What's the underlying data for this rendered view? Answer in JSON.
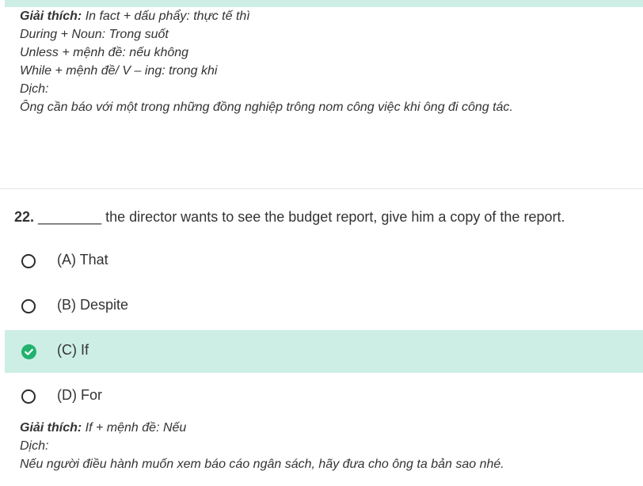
{
  "previous": {
    "explain_label": "Giải thích:",
    "explain_lines": [
      "In fact + dấu phẩy: thực tế thì",
      "During + Noun: Trong suốt",
      "Unless + mệnh đề: nếu không",
      "While + mệnh đề/ V – ing: trong khi"
    ],
    "translate_label": "Dịch:",
    "translation": "Ông cần báo với một trong những đồng nghiệp trông nom công việc khi ông đi công tác."
  },
  "question": {
    "number": "22.",
    "blank": "________",
    "text": " the director wants to see the budget report, give him a copy of the report.",
    "options": [
      {
        "label": "(A) That",
        "selected": false
      },
      {
        "label": "(B) Despite",
        "selected": false
      },
      {
        "label": "(C) If",
        "selected": true
      },
      {
        "label": "(D) For",
        "selected": false
      }
    ],
    "explain_label": "Giải thích:",
    "explain_text": " If + mệnh đề: Nếu",
    "translate_label": "Dịch:",
    "translation": "Nếu người điều hành muốn xem báo cáo ngân sách, hãy đưa cho ông ta bản sao nhé."
  },
  "colors": {
    "selected_bg": "#cdeee4",
    "check_green": "#22b26e"
  },
  "icons": {
    "radio": "radio-empty-icon",
    "selected": "check-circle-icon"
  }
}
